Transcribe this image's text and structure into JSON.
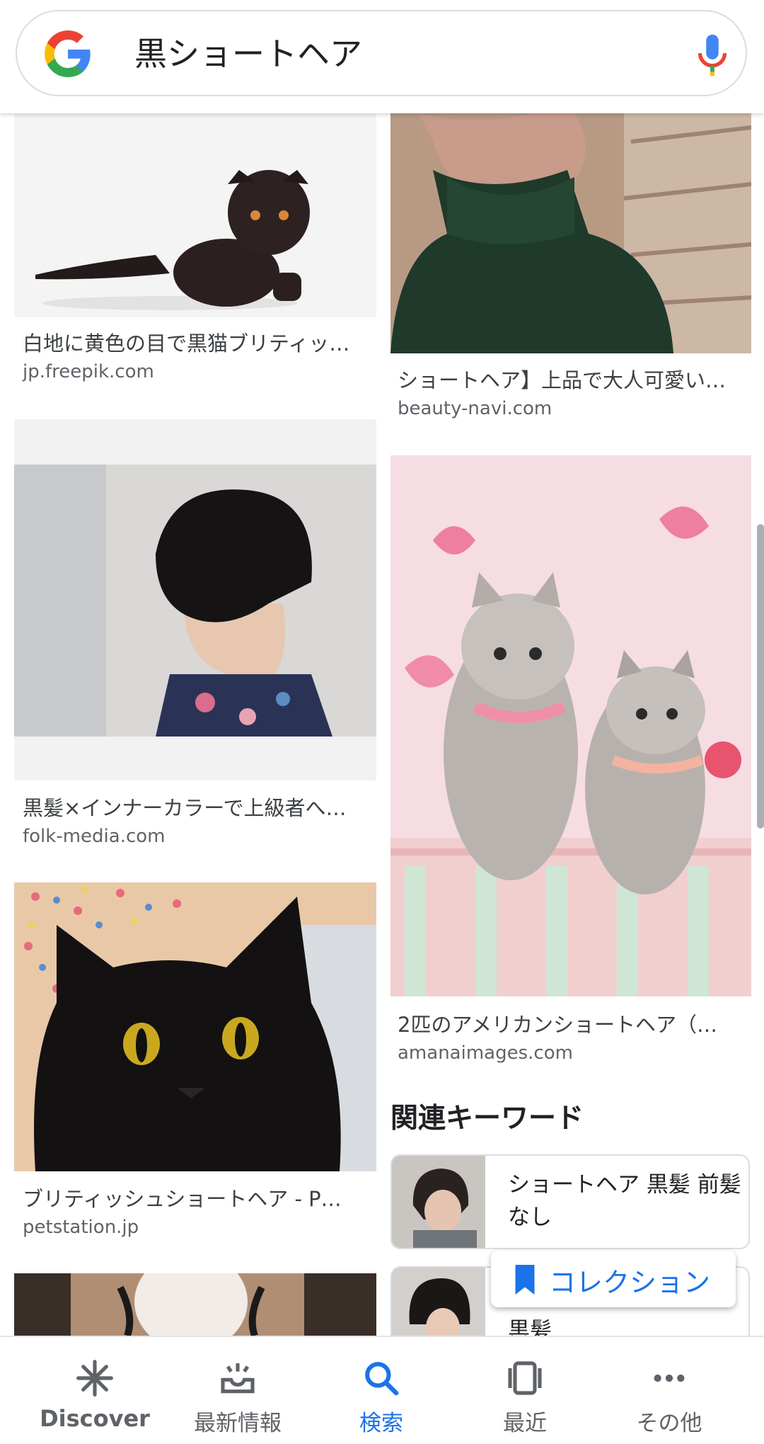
{
  "search": {
    "query": "黒ショートヘア"
  },
  "results": [
    {
      "caption": "白地に黄色の目で黒猫ブリティッ…",
      "domain": "jp.freepik.com"
    },
    {
      "caption": "ショートヘア】上品で大人可愛い…",
      "domain": "beauty-navi.com"
    },
    {
      "caption": "黒髪×インナーカラーで上級者へ…",
      "domain": "folk-media.com"
    },
    {
      "caption": "2匹のアメリカンショートヘア（…",
      "domain": "amanaimages.com"
    },
    {
      "caption": "ブリティッシュショートヘア - P…",
      "domain": "petstation.jp"
    }
  ],
  "related": {
    "title": "関連キーワード",
    "items": [
      {
        "label": "ショートヘア 黒髪 前髪なし"
      },
      {
        "label": "黒髪"
      }
    ]
  },
  "collection_button": {
    "label": "コレクション"
  },
  "bottom_nav": [
    {
      "label": "Discover",
      "icon": "asterisk-icon"
    },
    {
      "label": "最新情報",
      "icon": "inbox-icon"
    },
    {
      "label": "検索",
      "icon": "search-icon",
      "active": true
    },
    {
      "label": "最近",
      "icon": "recent-cards-icon"
    },
    {
      "label": "その他",
      "icon": "more-horiz-icon"
    }
  ],
  "colors": {
    "accent": "#1a73e8",
    "text": "#202124",
    "secondary": "#5f6368"
  }
}
